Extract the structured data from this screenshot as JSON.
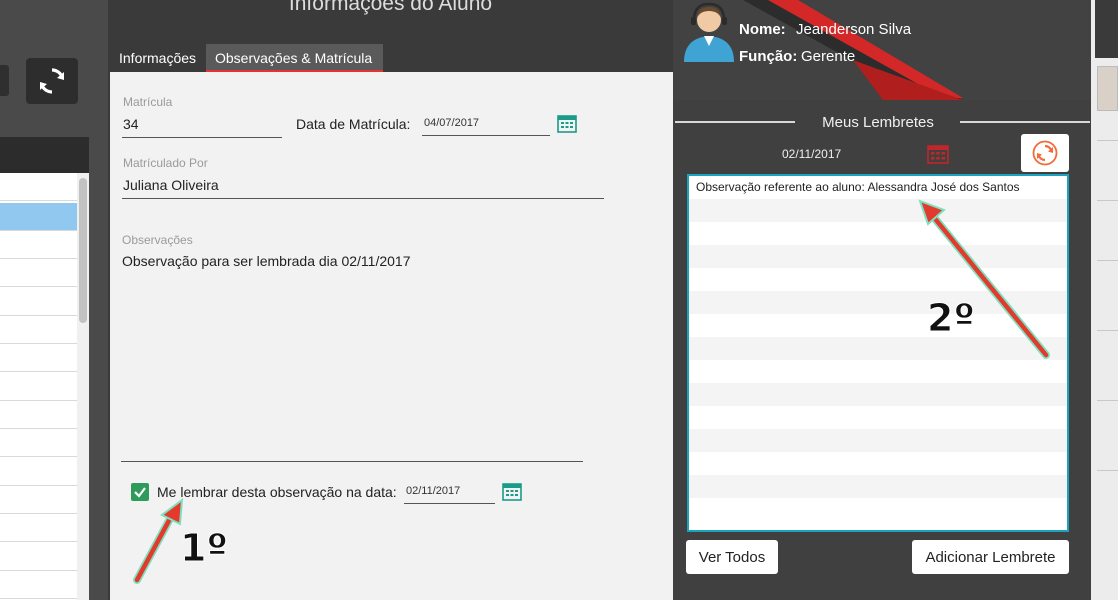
{
  "window": {
    "title": "Informações do Aluno"
  },
  "tabs": [
    {
      "label": "Informações",
      "active": false
    },
    {
      "label": "Observações & Matrícula",
      "active": true
    }
  ],
  "form": {
    "matricula_label": "Matrícula",
    "matricula_value": "34",
    "data_matricula_label": "Data de Matrícula:",
    "data_matricula_value": "04/07/2017",
    "matriculado_por_label": "Matrículado Por",
    "matriculado_por_value": "Juliana Oliveira",
    "observacoes_label": "Observações",
    "observacoes_value": "Observação para ser lembrada dia 02/11/2017",
    "reminder_checkbox_checked": true,
    "reminder_checkbox_label": "Me lembrar desta observação na data:",
    "reminder_date_value": "02/11/2017"
  },
  "user": {
    "nome_label": "Nome:",
    "nome_value": "Jeanderson Silva",
    "funcao_label": "Função:",
    "funcao_value": "Gerente"
  },
  "reminders": {
    "title": "Meus Lembretes",
    "date": "02/11/2017",
    "items": [
      "Observação referente ao aluno: Alessandra José dos Santos"
    ],
    "ver_todos_label": "Ver Todos",
    "adicionar_label": "Adicionar Lembrete"
  },
  "annotations": {
    "step1": "1º",
    "step2": "2º"
  },
  "colors": {
    "accent_red": "#e63232",
    "check_green": "#2e9b5a",
    "calendar_teal": "#1a9c8a",
    "list_border": "#1aa3c0",
    "refresh_orange": "#f26b3a",
    "selected_row": "#90c8f0"
  }
}
